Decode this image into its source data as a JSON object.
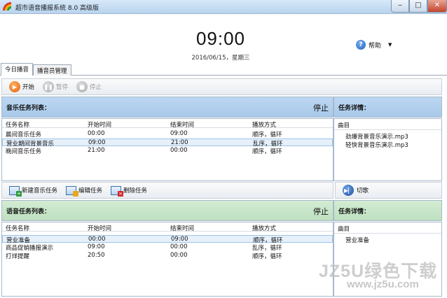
{
  "window": {
    "title": "超市语音播报系统 8.0 高级版"
  },
  "header": {
    "time": "09:00",
    "date": "2016/06/15，星期三",
    "help_label": "帮助"
  },
  "tabs": [
    {
      "label": "今日播音"
    },
    {
      "label": "播音员管理"
    }
  ],
  "toolbar_top": {
    "start": "开始",
    "pause": "暂停",
    "stop": "停止"
  },
  "music": {
    "title": "音乐任务列表：",
    "state": "停止",
    "columns": [
      "任务名称",
      "开始时间",
      "结束时间",
      "播放方式"
    ],
    "rows": [
      [
        "晨间音乐任务",
        "00:00",
        "09:00",
        "顺序，循环"
      ],
      [
        "营业期间背景音乐",
        "09:00",
        "21:00",
        "乱序，循环"
      ],
      [
        "晚间音乐任务",
        "21:00",
        "00:00",
        "顺序，循环"
      ]
    ],
    "detail": {
      "title": "任务详情：",
      "header": "曲目",
      "items": [
        "劲爆背景音乐演示.mp3",
        "轻快背景音乐演示.mp3"
      ]
    }
  },
  "toolbar_mid": {
    "new": "新建音乐任务",
    "edit": "编辑任务",
    "delete": "删除任务",
    "switch": "切歌"
  },
  "voice": {
    "title": "语音任务列表：",
    "state": "停止",
    "columns": [
      "任务名称",
      "开始时间",
      "结束时间",
      "播放方式"
    ],
    "rows": [
      [
        "营业准备",
        "00:00",
        "09:00",
        "顺序，循环"
      ],
      [
        "商品促销播报演示",
        "09:00",
        "00:00",
        "乱序，循环"
      ],
      [
        "打烊提醒",
        "20:50",
        "00:00",
        "顺序，循环"
      ]
    ],
    "detail": {
      "title": "任务详情：",
      "header": "曲目",
      "items": [
        "营业准备"
      ]
    }
  },
  "watermark": {
    "line1": "JZ5U绿色下载",
    "line2": "www.jz5u.com"
  }
}
